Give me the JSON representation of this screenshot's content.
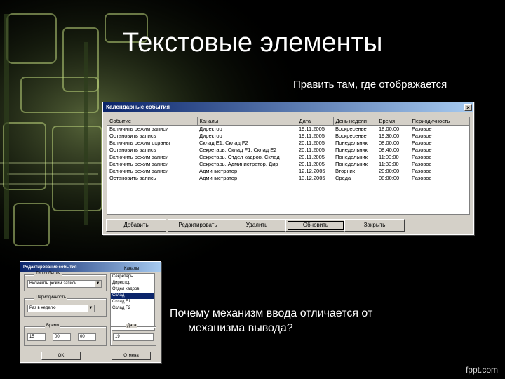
{
  "slide": {
    "title": "Текстовые элементы",
    "subtitle": "Править там, где отображается",
    "question_line1": "Почему механизм ввода отличается от",
    "question_line2": "механизма вывода?",
    "brand": "fppt.com"
  },
  "main_dialog": {
    "title": "Календарные события",
    "close_label": "×",
    "columns": [
      "Событие",
      "Каналы",
      "Дата",
      "День недели",
      "Время",
      "Периодичность"
    ],
    "rows": [
      [
        "Включить режим записи",
        "Директор",
        "19.11.2005",
        "Воскресенье",
        "18:00:00",
        "Разовое"
      ],
      [
        "Остановить запись",
        "Директор",
        "19.11.2005",
        "Воскресенье",
        "19:30:00",
        "Разовое"
      ],
      [
        "Включить режим охраны",
        "Склад E1, Склад F2",
        "20.11.2005",
        "Понедельник",
        "08:00:00",
        "Разовое"
      ],
      [
        "Остановить запись",
        "Секретарь, Склад F1, Склад E2",
        "20.11.2005",
        "Понедельник",
        "08:40:00",
        "Разовое"
      ],
      [
        "Включить режим записи",
        "Секретарь, Отдел кадров, Склад",
        "20.11.2005",
        "Понедельник",
        "11:00:00",
        "Разовое"
      ],
      [
        "Включить режим записи",
        "Секретарь, Администратор, Дир",
        "20.11.2005",
        "Понедельник",
        "11:30:00",
        "Разовое"
      ],
      [
        "Включить режим записи",
        "Администратор",
        "12.12.2005",
        "Вторник",
        "20:00:00",
        "Разовое"
      ],
      [
        "Остановить запись",
        "Администратор",
        "13.12.2005",
        "Среда",
        "08:00:00",
        "Разовое"
      ]
    ],
    "buttons": {
      "add": "Добавить",
      "edit": "Редактировать",
      "delete": "Удалить",
      "refresh": "Обновить",
      "close": "Закрыть"
    }
  },
  "sub_dialog": {
    "title": "Редактирование события",
    "event_group": "Тип события",
    "event_value": "Включить режим записи",
    "period_group": "Периодичность",
    "period_value": "Раз в неделю",
    "channels_label": "Каналы",
    "channels": [
      "Секретарь",
      "Директор",
      "Отдел кадров",
      "Склад",
      "Склад E1",
      "Склад F2"
    ],
    "channels_selected_index": 3,
    "time_group": "Время",
    "hour": "15",
    "minute": "00",
    "second": "00",
    "date_group": "Дата",
    "date_value": "19",
    "ok_label": "OK",
    "cancel_label": "Отмена"
  }
}
